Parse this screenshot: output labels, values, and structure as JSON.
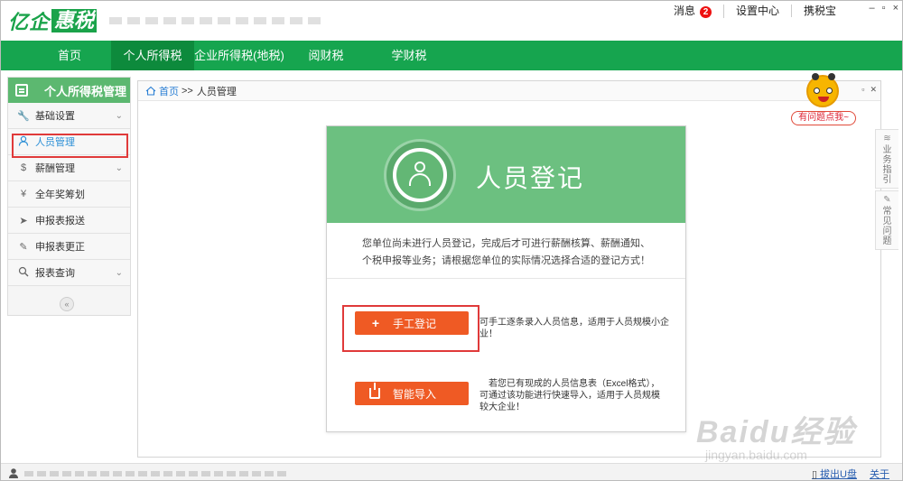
{
  "app": {
    "logo_part1": "亿企",
    "logo_part2": "惠税"
  },
  "titlebar": {
    "messages_label": "消息",
    "messages_count": "2",
    "settings_label": "设置中心",
    "carry_label": "携税宝",
    "win_min": "–",
    "win_restore": "▫",
    "win_close": "×"
  },
  "nav": {
    "items": [
      "首页",
      "个人所得税",
      "企业所得税(地税)",
      "阅财税",
      "学财税"
    ],
    "active_index": 1
  },
  "sidebar": {
    "title": "个人所得税管理",
    "items": [
      {
        "label": "基础设置",
        "icon": "wrench-icon",
        "glyph": "🔧",
        "has_chevron": true
      },
      {
        "label": "人员管理",
        "icon": "person-icon",
        "glyph": "👤",
        "active": true
      },
      {
        "label": "薪酬管理",
        "icon": "salary-icon",
        "glyph": "$",
        "has_chevron": true
      },
      {
        "label": "全年奖筹划",
        "icon": "bonus-icon",
        "glyph": "¥"
      },
      {
        "label": "申报表报送",
        "icon": "send-icon",
        "glyph": "➤"
      },
      {
        "label": "申报表更正",
        "icon": "edit-icon",
        "glyph": "✎"
      },
      {
        "label": "报表查询",
        "icon": "search-icon",
        "glyph": "⚲",
        "has_chevron": true
      }
    ],
    "collapse": "«"
  },
  "breadcrumb": {
    "home": "首页",
    "sep": ">>",
    "current": "人员管理"
  },
  "mascot": {
    "tag": "有问题点我~"
  },
  "right_tabs": [
    {
      "label": "业务指引",
      "icon": "layers-icon"
    },
    {
      "label": "常见问题",
      "icon": "note-icon"
    }
  ],
  "dialog": {
    "title": "人员登记",
    "message_line1": "您单位尚未进行人员登记，完成后才可进行薪酬核算、薪酬通知、",
    "message_line2": "个税申报等业务；请根据您单位的实际情况选择合适的登记方式！",
    "manual_button": "手工登记",
    "manual_desc": "可手工逐条录入人员信息，适用于人员规模小企业！",
    "import_button": "智能导入",
    "import_desc_1": "若您已有现成的人员信息表（Excel格式），",
    "import_desc_2": "可通过该功能进行快速导入，适用于人员规模",
    "import_desc_3": "较大企业！"
  },
  "statusbar": {
    "eject": "拔出U盘",
    "about": "关于"
  },
  "watermark": {
    "line1": "Baidu经验",
    "line2": "jingyan.baidu.com"
  },
  "colors": {
    "brand_green": "#16a54f",
    "accent_orange": "#ef5a24",
    "highlight_red": "#e03a3a",
    "link_blue": "#2a7fd4"
  }
}
